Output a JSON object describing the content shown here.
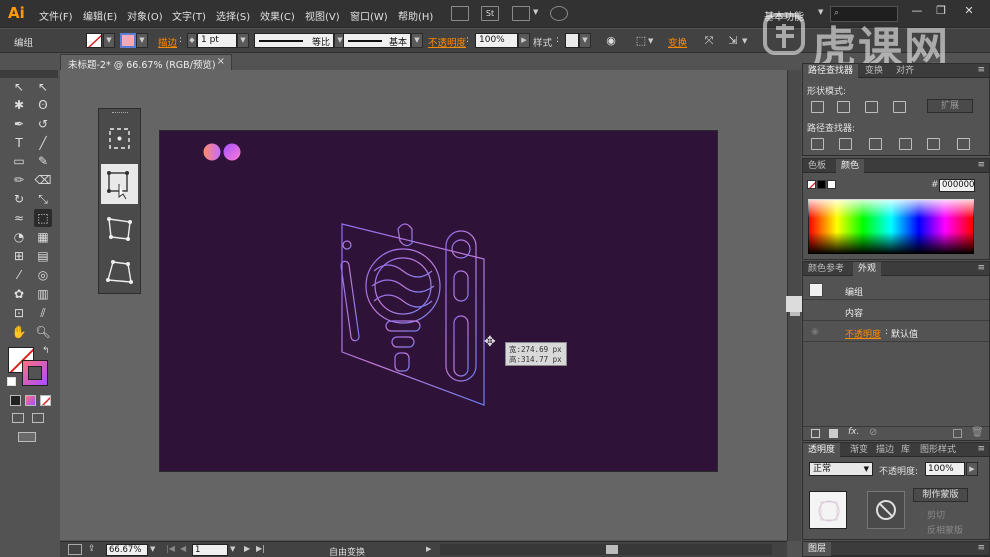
{
  "app": {
    "logo": "Ai"
  },
  "menu": [
    "文件(F)",
    "编辑(E)",
    "对象(O)",
    "文字(T)",
    "选择(S)",
    "效果(C)",
    "视图(V)",
    "窗口(W)",
    "帮助(H)"
  ],
  "topbar": {
    "st_icon_label": "St",
    "workspace": "基本功能",
    "window_controls": [
      "—",
      "❐",
      "✕"
    ]
  },
  "control_bar": {
    "selection_label": "编组",
    "stroke_label": "描边",
    "stroke_width": "1 pt",
    "stroke_profile": "等比",
    "brush": "基本",
    "opacity_label": "不透明度",
    "opacity_value": "100%",
    "style_label": "样式",
    "transform_label": "变换"
  },
  "document_tab": {
    "title": "未标题-2* @ 66.67% (RGB/预览)",
    "close": "×"
  },
  "tooltip": {
    "width_line": "宽:274.69 px",
    "height_line": "高:314.77 px"
  },
  "status_bar": {
    "zoom": "66.67%",
    "page": "1",
    "status_text": "自由变换"
  },
  "pathfinder_panel": {
    "tabs": [
      "路径查找器",
      "变换",
      "对齐"
    ],
    "shape_modes_label": "形状模式:",
    "expand_button": "扩展",
    "pathfinders_label": "路径查找器:"
  },
  "color_panel": {
    "tabs": [
      "色板",
      "颜色"
    ],
    "hex": "000000"
  },
  "appearance_panel": {
    "tabs": [
      "颜色参考",
      "外观"
    ],
    "rows": [
      {
        "label": "编组"
      },
      {
        "label": "内容"
      },
      {
        "label": "不透明度",
        "value": "默认值"
      }
    ],
    "opacity_value_sep": ":",
    "footer_fx": "fx."
  },
  "transparency_panel": {
    "tabs": [
      "透明度",
      "渐变",
      "描边",
      "库",
      "图形样式"
    ],
    "blend_mode": "正常",
    "opacity_label": "不透明度:",
    "opacity_value": "100%",
    "make_mask_button": "制作蒙版",
    "clip_label": "剪切",
    "invert_mask_label": "反相蒙版"
  },
  "layers_panel": {
    "tab": "图层"
  },
  "watermark": {
    "text": "虎课网"
  },
  "colors": {
    "artboard": "#2f1237",
    "orange_accent": "#ff8a00",
    "gradient_a": "#ff6f7f",
    "gradient_b": "#a74dff",
    "line_color": "#7f6fe0"
  }
}
